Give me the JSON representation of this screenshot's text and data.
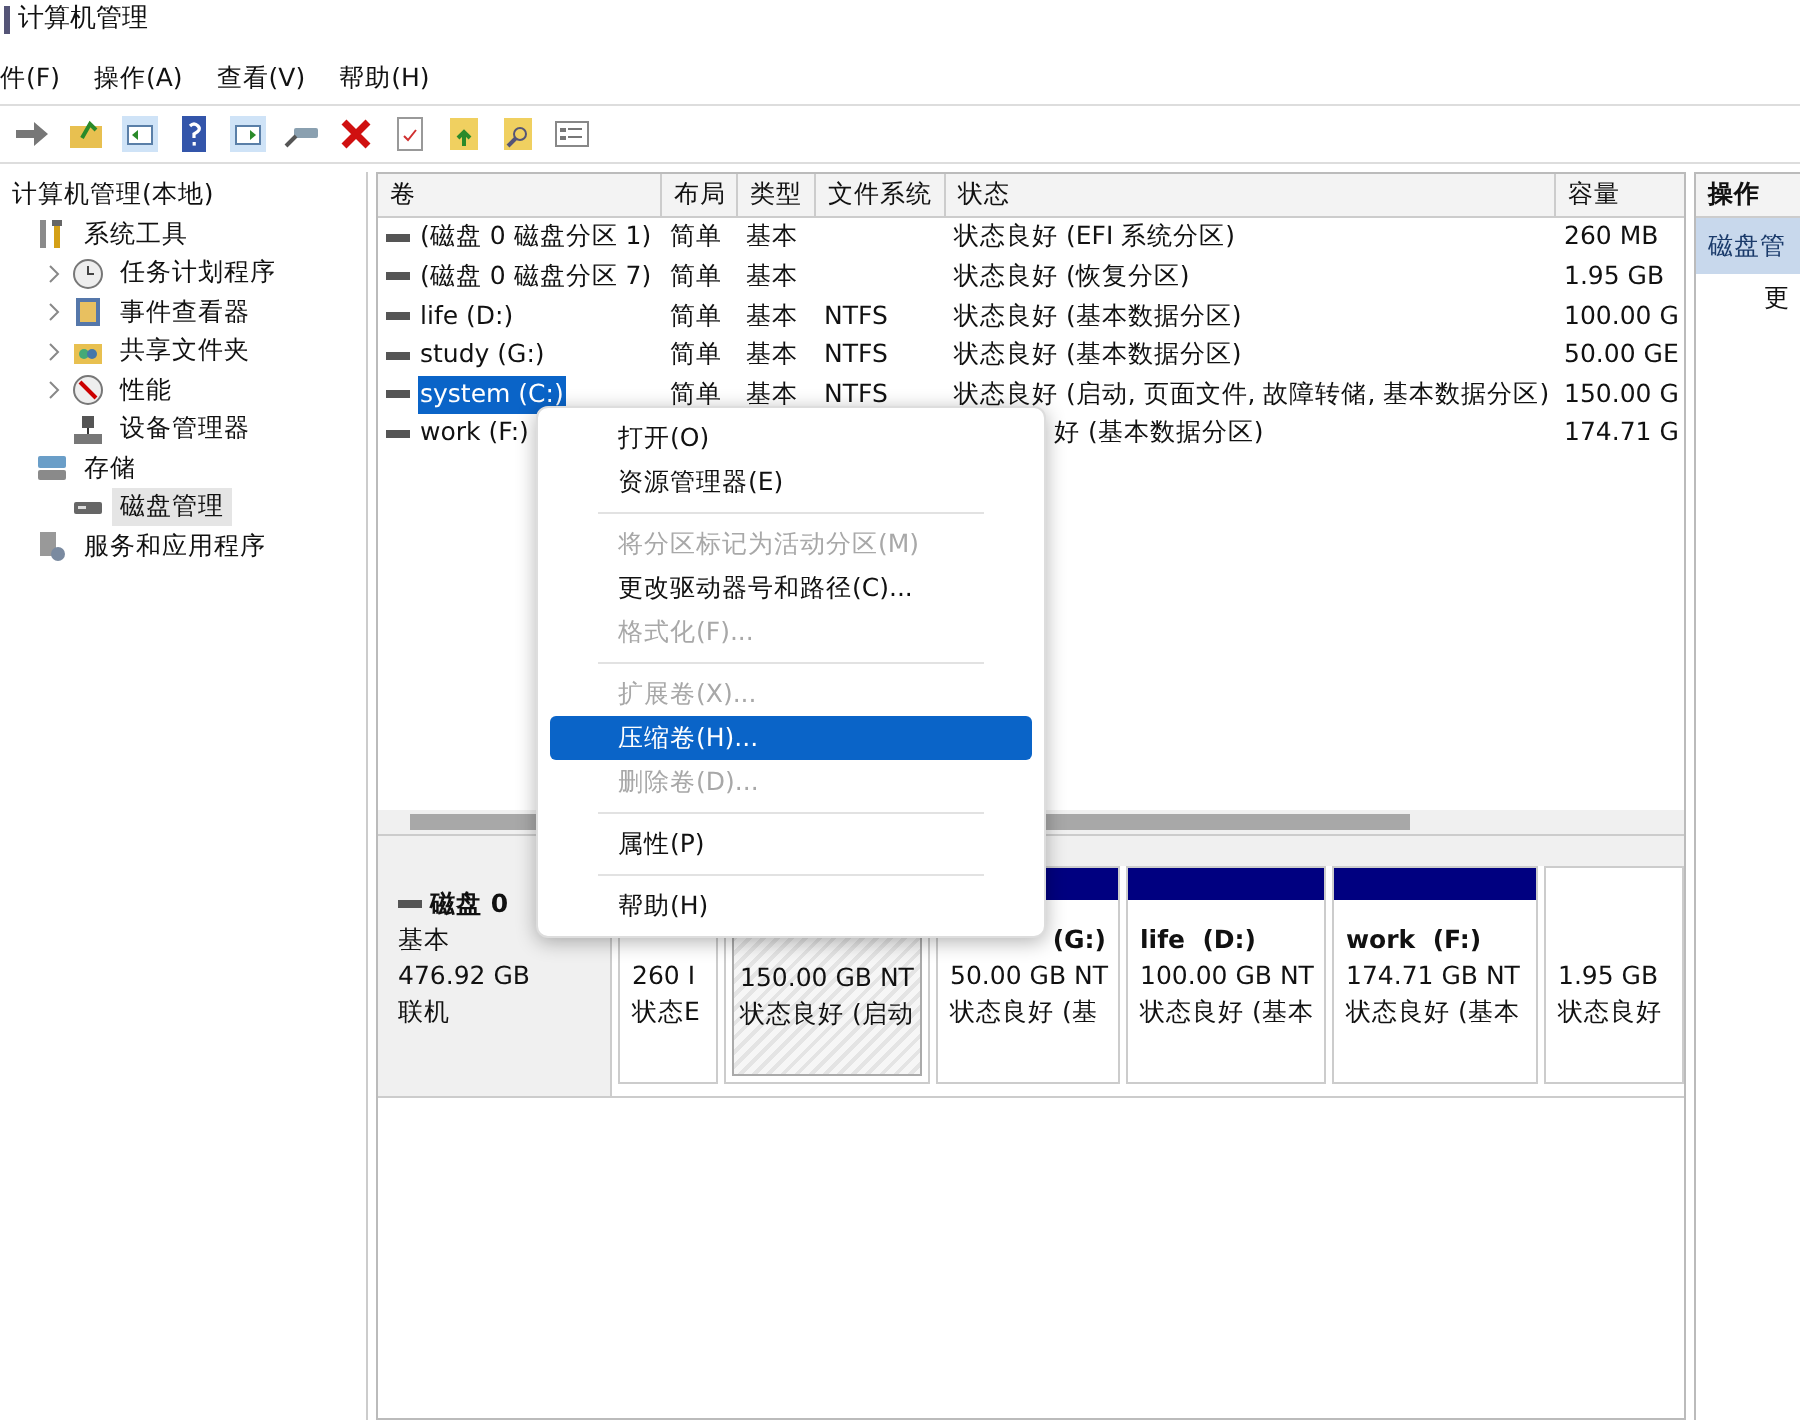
{
  "window": {
    "title": "计算机管理"
  },
  "menu_bar": [
    "件(F)",
    "操作(A)",
    "查看(V)",
    "帮助(H)"
  ],
  "tree": {
    "label": "计算机管理(本地)",
    "children": [
      {
        "label": "系统工具",
        "selected": false,
        "collapsed": false,
        "children": [
          {
            "label": "任务计划程序",
            "selected": false,
            "collapsed": true
          },
          {
            "label": "事件查看器",
            "selected": false,
            "collapsed": true
          },
          {
            "label": "共享文件夹",
            "selected": false,
            "collapsed": true
          },
          {
            "label": "性能",
            "selected": false,
            "collapsed": true
          },
          {
            "label": "设备管理器",
            "selected": false,
            "collapsed": false
          }
        ]
      },
      {
        "label": "存储",
        "selected": false,
        "collapsed": false,
        "children": [
          {
            "label": "磁盘管理",
            "selected": true,
            "collapsed": false
          }
        ]
      },
      {
        "label": "服务和应用程序",
        "selected": false,
        "collapsed": false
      }
    ]
  },
  "table": {
    "columns": [
      "卷",
      "布局",
      "类型",
      "文件系统",
      "状态",
      "容量"
    ],
    "rows": [
      {
        "volume": "(磁盘 0 磁盘分区 1)",
        "layout": "简单",
        "type": "基本",
        "fs": "",
        "status": "状态良好 (EFI 系统分区)",
        "capacity": "260 MB",
        "selected": false
      },
      {
        "volume": "(磁盘 0 磁盘分区 7)",
        "layout": "简单",
        "type": "基本",
        "fs": "",
        "status": "状态良好 (恢复分区)",
        "capacity": "1.95 GB",
        "selected": false
      },
      {
        "volume": "life (D:)",
        "layout": "简单",
        "type": "基本",
        "fs": "NTFS",
        "status": "状态良好 (基本数据分区)",
        "capacity": "100.00 G",
        "selected": false
      },
      {
        "volume": "study (G:)",
        "layout": "简单",
        "type": "基本",
        "fs": "NTFS",
        "status": "状态良好 (基本数据分区)",
        "capacity": "50.00 GE",
        "selected": false
      },
      {
        "volume": "system (C:)",
        "layout": "简单",
        "type": "基本",
        "fs": "NTFS",
        "status": "状态良好 (启动, 页面文件, 故障转储, 基本数据分区)",
        "capacity": "150.00 G",
        "selected": true
      },
      {
        "volume": "work (F:)",
        "status": "好 (基本数据分区)",
        "capacity": "174.71 G",
        "selected": false
      }
    ]
  },
  "disk": {
    "name": "磁盘 0",
    "type": "基本",
    "size": "476.92 GB",
    "state": "联机",
    "partitions": [
      {
        "lines": [
          "260 I",
          "状态E"
        ],
        "selected": false
      },
      {
        "lines": [
          "150.00 GB NT",
          "状态良好 (启动"
        ],
        "selected": true
      },
      {
        "name": "(G:)",
        "lines": [
          "50.00 GB NT",
          "状态良好 (基"
        ],
        "selected": false
      },
      {
        "name": "life  (D:)",
        "lines": [
          "100.00 GB NT",
          "状态良好 (基本"
        ],
        "selected": false
      },
      {
        "name": "work  (F:)",
        "lines": [
          "174.71 GB NT",
          "状态良好 (基本"
        ],
        "selected": false
      },
      {
        "lines": [
          "1.95 GB",
          "状态良好"
        ],
        "selected": false
      }
    ]
  },
  "context_menu": [
    {
      "items": [
        {
          "label": "打开(O)",
          "disabled": false,
          "selected": false
        },
        {
          "label": "资源管理器(E)",
          "disabled": false,
          "selected": false
        }
      ]
    },
    {
      "items": [
        {
          "label": "将分区标记为活动分区(M)",
          "disabled": true,
          "selected": false
        },
        {
          "label": "更改驱动器号和路径(C)...",
          "disabled": false,
          "selected": false
        },
        {
          "label": "格式化(F)...",
          "disabled": true,
          "selected": false
        }
      ]
    },
    {
      "items": [
        {
          "label": "扩展卷(X)...",
          "disabled": true,
          "selected": false
        },
        {
          "label": "压缩卷(H)...",
          "disabled": false,
          "selected": true
        },
        {
          "label": "删除卷(D)...",
          "disabled": true,
          "selected": false
        }
      ]
    },
    {
      "items": [
        {
          "label": "属性(P)",
          "disabled": false,
          "selected": false
        }
      ]
    },
    {
      "items": [
        {
          "label": "帮助(H)",
          "disabled": false,
          "selected": false
        }
      ]
    }
  ],
  "actions": {
    "title": "操作",
    "items": [
      {
        "label": "磁盘管",
        "selected": true
      },
      {
        "label": "更",
        "selected": false
      }
    ]
  }
}
